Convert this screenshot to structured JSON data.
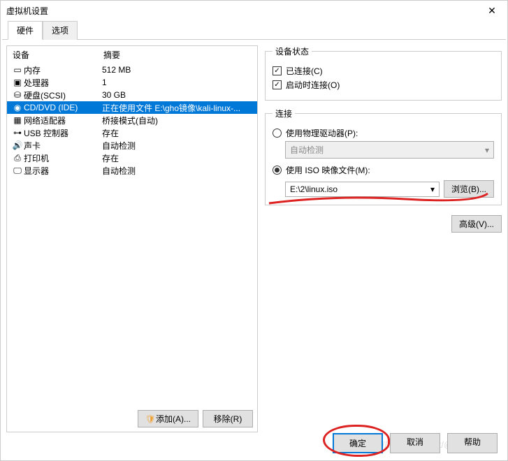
{
  "window": {
    "title": "虚拟机设置"
  },
  "tabs": {
    "hardware": "硬件",
    "options": "选项"
  },
  "device_header": {
    "device": "设备",
    "summary": "摘要"
  },
  "devices": [
    {
      "icon": "memory-icon",
      "name": "内存",
      "summary": "512 MB"
    },
    {
      "icon": "cpu-icon",
      "name": "处理器",
      "summary": "1"
    },
    {
      "icon": "disk-icon",
      "name": "硬盘(SCSI)",
      "summary": "30 GB"
    },
    {
      "icon": "cd-icon",
      "name": "CD/DVD (IDE)",
      "summary": "正在使用文件 E:\\gho镜像\\kali-linux-..."
    },
    {
      "icon": "nic-icon",
      "name": "网络适配器",
      "summary": "桥接模式(自动)"
    },
    {
      "icon": "usb-icon",
      "name": "USB 控制器",
      "summary": "存在"
    },
    {
      "icon": "sound-icon",
      "name": "声卡",
      "summary": "自动检测"
    },
    {
      "icon": "printer-icon",
      "name": "打印机",
      "summary": "存在"
    },
    {
      "icon": "display-icon",
      "name": "显示器",
      "summary": "自动检测"
    }
  ],
  "selected_index": 3,
  "left_buttons": {
    "add": "添加(A)...",
    "remove": "移除(R)"
  },
  "status_group": {
    "legend": "设备状态",
    "connected": "已连接(C)",
    "connect_at_poweron": "启动时连接(O)"
  },
  "connection_group": {
    "legend": "连接",
    "use_physical": "使用物理驱动器(P):",
    "physical_value": "自动检测",
    "use_iso": "使用 ISO 映像文件(M):",
    "iso_value": "E:\\2\\linux.iso",
    "browse": "浏览(B)..."
  },
  "advanced": "高级(V)...",
  "bottom": {
    "ok": "确定",
    "cancel": "取消",
    "help": "帮助"
  },
  "watermark": "http://blog.csdn.net/@510刘宏"
}
